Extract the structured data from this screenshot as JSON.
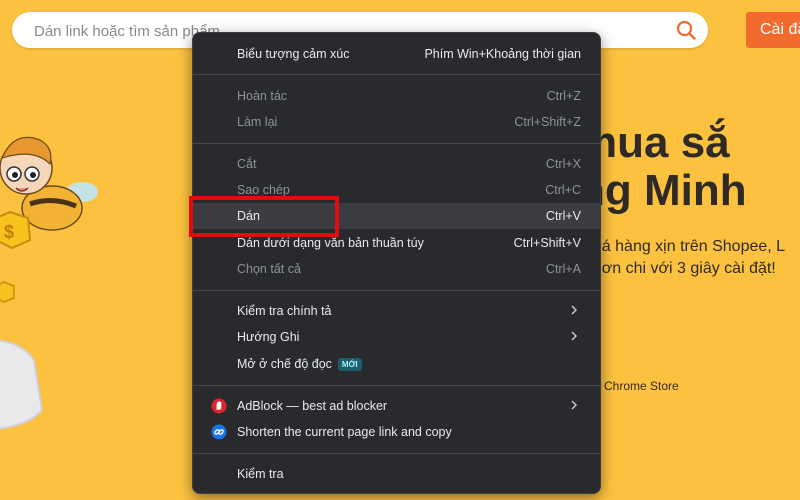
{
  "search": {
    "placeholder": "Dán link hoặc tìm sản phẩm",
    "button_label": "Cài đặ"
  },
  "hero": {
    "line1": "mua sắ",
    "line2": "ng Minh",
    "sub1": "h giá hàng xịn trên Shopee, L",
    "sub2": "ái hơn chi với 3 giây cài đặt!",
    "store_label": "Chrome Store"
  },
  "menu": {
    "emoji": {
      "label": "Biểu tượng cảm xúc",
      "shortcut": "Phím Win+Khoảng thời gian"
    },
    "undo": {
      "label": "Hoàn tác",
      "shortcut": "Ctrl+Z"
    },
    "redo": {
      "label": "Làm lại",
      "shortcut": "Ctrl+Shift+Z"
    },
    "cut": {
      "label": "Cắt",
      "shortcut": "Ctrl+X"
    },
    "copy": {
      "label": "Sao chép",
      "shortcut": "Ctrl+C"
    },
    "paste": {
      "label": "Dán",
      "shortcut": "Ctrl+V"
    },
    "paste_plain": {
      "label": "Dán dưới dạng văn bản thuần túy",
      "shortcut": "Ctrl+Shift+V"
    },
    "select_all": {
      "label": "Chọn tất cả",
      "shortcut": "Ctrl+A"
    },
    "spellcheck": {
      "label": "Kiểm tra chính tả"
    },
    "writing_direction": {
      "label": "Hướng Ghi"
    },
    "reading_mode": {
      "label": "Mở ở chế độ đọc",
      "badge": "MỚI"
    },
    "adblock": {
      "label": "AdBlock — best ad blocker"
    },
    "shorten_link": {
      "label": "Shorten the current page link and copy"
    },
    "inspect": {
      "label": "Kiểm tra"
    }
  },
  "colors": {
    "page_background": "#fcc23f",
    "menu_background": "#292a2d",
    "highlight_border": "#e30b0b",
    "accent_orange": "#f26a2e"
  },
  "icons": {
    "search": "magnifier",
    "adblock": "red-hand-stop",
    "shorten": "blue-link"
  }
}
